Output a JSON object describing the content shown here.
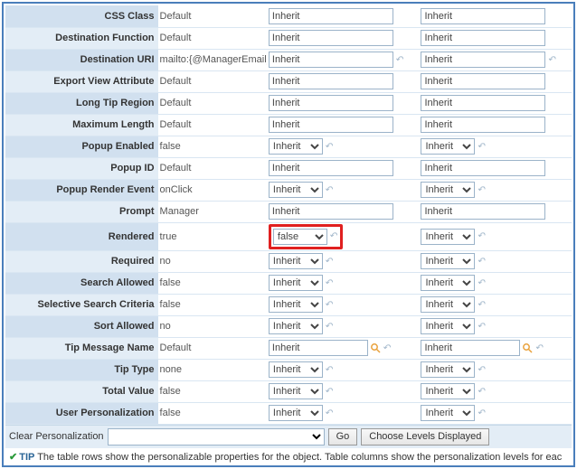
{
  "inherit": "Inherit",
  "rows": [
    {
      "label": "CSS Class",
      "value": "Default",
      "c1": {
        "type": "text"
      },
      "c2": {
        "type": "text"
      }
    },
    {
      "label": "Destination Function",
      "value": "Default",
      "c1": {
        "type": "text"
      },
      "c2": {
        "type": "text"
      }
    },
    {
      "label": "Destination URI",
      "value": "mailto:{@ManagerEmail}",
      "c1": {
        "type": "text",
        "undo": true
      },
      "c2": {
        "type": "text",
        "undo": true
      }
    },
    {
      "label": "Export View Attribute",
      "value": "Default",
      "c1": {
        "type": "text"
      },
      "c2": {
        "type": "text"
      }
    },
    {
      "label": "Long Tip Region",
      "value": "Default",
      "c1": {
        "type": "text"
      },
      "c2": {
        "type": "text"
      }
    },
    {
      "label": "Maximum Length",
      "value": "Default",
      "c1": {
        "type": "text"
      },
      "c2": {
        "type": "text"
      }
    },
    {
      "label": "Popup Enabled",
      "value": "false",
      "c1": {
        "type": "select",
        "undo": true
      },
      "c2": {
        "type": "select",
        "undo": true
      }
    },
    {
      "label": "Popup ID",
      "value": "Default",
      "c1": {
        "type": "text"
      },
      "c2": {
        "type": "text"
      }
    },
    {
      "label": "Popup Render Event",
      "value": "onClick",
      "c1": {
        "type": "select",
        "undo": true
      },
      "c2": {
        "type": "select",
        "undo": true
      }
    },
    {
      "label": "Prompt",
      "value": "Manager",
      "c1": {
        "type": "text"
      },
      "c2": {
        "type": "text"
      }
    },
    {
      "label": "Rendered",
      "value": "true",
      "c1": {
        "type": "select",
        "sel": "false",
        "undo": true,
        "hl": true
      },
      "c2": {
        "type": "select",
        "undo": true
      }
    },
    {
      "label": "Required",
      "value": "no",
      "c1": {
        "type": "select",
        "undo": true
      },
      "c2": {
        "type": "select",
        "undo": true
      }
    },
    {
      "label": "Search Allowed",
      "value": "false",
      "c1": {
        "type": "select",
        "undo": true
      },
      "c2": {
        "type": "select",
        "undo": true
      }
    },
    {
      "label": "Selective Search Criteria",
      "value": "false",
      "c1": {
        "type": "select",
        "undo": true
      },
      "c2": {
        "type": "select",
        "undo": true
      }
    },
    {
      "label": "Sort Allowed",
      "value": "no",
      "c1": {
        "type": "select",
        "undo": true
      },
      "c2": {
        "type": "select",
        "undo": true
      }
    },
    {
      "label": "Tip Message Name",
      "value": "Default",
      "c1": {
        "type": "lookup",
        "undo": true
      },
      "c2": {
        "type": "lookup",
        "undo": true
      }
    },
    {
      "label": "Tip Type",
      "value": "none",
      "c1": {
        "type": "select",
        "undo": true
      },
      "c2": {
        "type": "select",
        "undo": true
      }
    },
    {
      "label": "Total Value",
      "value": "false",
      "c1": {
        "type": "select",
        "undo": true
      },
      "c2": {
        "type": "select",
        "undo": true
      }
    },
    {
      "label": "User Personalization",
      "value": "false",
      "c1": {
        "type": "select",
        "undo": true
      },
      "c2": {
        "type": "select",
        "undo": true
      }
    }
  ],
  "footer": {
    "clear_label": "Clear Personalization",
    "go_label": "Go",
    "choose_label": "Choose Levels Displayed"
  },
  "tip": {
    "prefix": "TIP",
    "text": " The table rows show the personalizable properties for the object. Table columns show the personalization levels for eac"
  }
}
